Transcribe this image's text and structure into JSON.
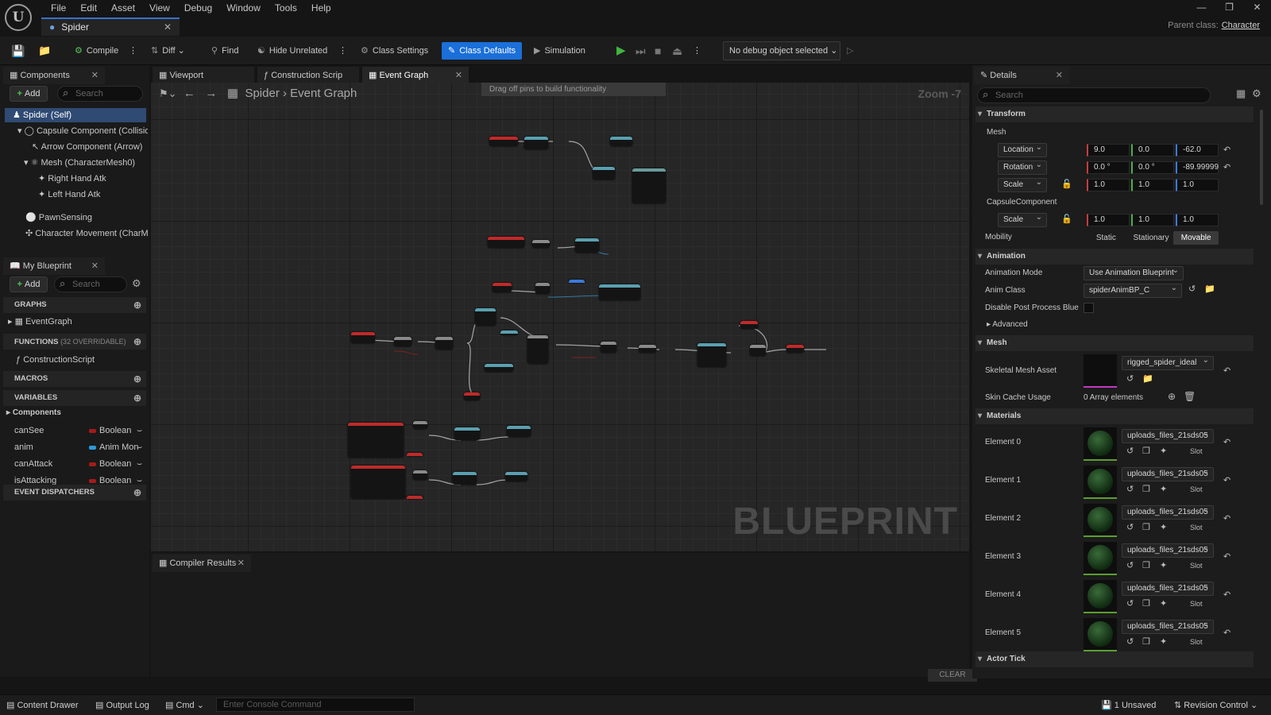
{
  "menu": [
    "File",
    "Edit",
    "Asset",
    "View",
    "Debug",
    "Window",
    "Tools",
    "Help"
  ],
  "doc_tab": {
    "label": "Spider"
  },
  "parent_class": {
    "label": "Parent class:",
    "value": "Character"
  },
  "toolbar": {
    "compile": "Compile",
    "diff": "Diff",
    "find": "Find",
    "hide_unrelated": "Hide Unrelated",
    "class_settings": "Class Settings",
    "class_defaults": "Class Defaults",
    "simulation": "Simulation",
    "debug_object": "No debug object selected"
  },
  "components": {
    "title": "Components",
    "add": "Add",
    "search_placeholder": "Search",
    "items": [
      "Spider (Self)",
      "Capsule Component (CollisionCylinder)",
      "Arrow Component (Arrow)",
      "Mesh (CharacterMesh0)",
      "Right Hand Atk",
      "Left Hand Atk",
      "PawnSensing",
      "Character Movement (CharMoveComp)"
    ]
  },
  "my_blueprint": {
    "title": "My Blueprint",
    "add": "Add",
    "search_placeholder": "Search",
    "graphs": "GRAPHS",
    "event_graph": "EventGraph",
    "functions": "FUNCTIONS",
    "functions_count": "(32 OVERRIDABLE)",
    "construction_script": "ConstructionScript",
    "macros": "MACROS",
    "variables": "VARIABLES",
    "components_group": "Components",
    "vars": [
      {
        "name": "canSee",
        "type": "Boolean",
        "color": "#a61a1a"
      },
      {
        "name": "anim",
        "type": "Anim Montage",
        "color": "#2a9ad9"
      },
      {
        "name": "canAttack",
        "type": "Boolean",
        "color": "#a61a1a"
      },
      {
        "name": "isAttacking",
        "type": "Boolean",
        "color": "#a61a1a"
      }
    ],
    "event_dispatchers": "EVENT DISPATCHERS"
  },
  "editor_tabs": [
    "Viewport",
    "Construction Script",
    "Event Graph"
  ],
  "graph": {
    "breadcrumb_root": "Spider",
    "breadcrumb_leaf": "Event Graph",
    "zoom": "Zoom -7",
    "hint": "Drag off pins to build functionality",
    "watermark": "BLUEPRINT"
  },
  "compiler": {
    "title": "Compiler Results",
    "clear": "CLEAR"
  },
  "details": {
    "title": "Details",
    "search_placeholder": "Search",
    "transform": "Transform",
    "mesh_sub": "Mesh",
    "location": "Location",
    "location_vals": [
      "9.0",
      "0.0",
      "-62.0"
    ],
    "rotation": "Rotation",
    "rotation_vals": [
      "0.0 °",
      "0.0 °",
      "-89.99999"
    ],
    "scale": "Scale",
    "scale_vals": [
      "1.0",
      "1.0",
      "1.0"
    ],
    "capsule_sub": "CapsuleComponent",
    "capsule_scale_vals": [
      "1.0",
      "1.0",
      "1.0"
    ],
    "mobility": "Mobility",
    "mobility_opts": [
      "Static",
      "Stationary",
      "Movable"
    ],
    "animation": "Animation",
    "anim_mode_label": "Animation Mode",
    "anim_mode": "Use Animation Blueprint",
    "anim_class_label": "Anim Class",
    "anim_class": "spiderAnimBP_C",
    "disable_pp": "Disable Post Process Blueprint",
    "advanced": "Advanced",
    "mesh": "Mesh",
    "skel_mesh_label": "Skeletal Mesh Asset",
    "skel_mesh": "rigged_spider_ideal",
    "skin_cache_label": "Skin Cache Usage",
    "skin_cache": "0 Array elements",
    "materials": "Materials",
    "slot": "Slot",
    "elements": [
      {
        "label": "Element 0",
        "value": "uploads_files_21sds05"
      },
      {
        "label": "Element 1",
        "value": "uploads_files_21sds05"
      },
      {
        "label": "Element 2",
        "value": "uploads_files_21sds05"
      },
      {
        "label": "Element 3",
        "value": "uploads_files_21sds05"
      },
      {
        "label": "Element 4",
        "value": "uploads_files_21sds05"
      },
      {
        "label": "Element 5",
        "value": "uploads_files_21sds05"
      }
    ],
    "actor_tick": "Actor Tick"
  },
  "statusbar": {
    "content_drawer": "Content Drawer",
    "output_log": "Output Log",
    "cmd": "Cmd",
    "console_placeholder": "Enter Console Command",
    "unsaved": "1 Unsaved",
    "revision": "Revision Control"
  }
}
